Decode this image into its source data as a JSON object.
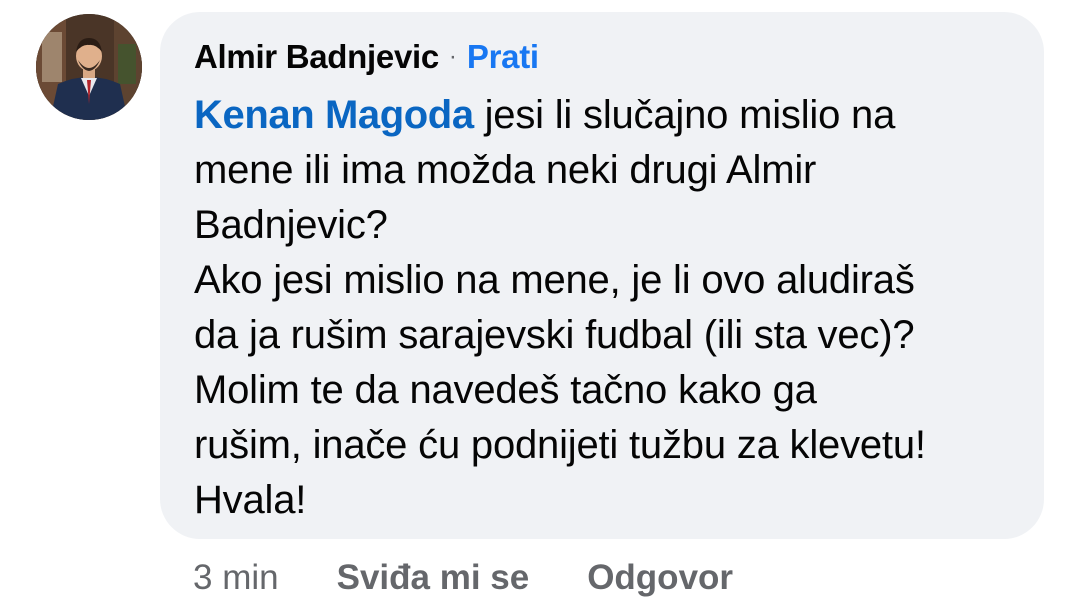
{
  "comment": {
    "author": "Almir Badnjevic",
    "separator": "·",
    "follow_label": "Prati",
    "mention": "Kenan Magoda",
    "lines": [
      " jesi li slučajno mislio na",
      "mene ili ima možda neki drugi Almir",
      "Badnjevic?",
      "Ako jesi mislio na mene, je li ovo aludiraš",
      "da ja rušim sarajevski fudbal (ili sta vec)?",
      "Molim te da navedeš tačno kako ga",
      "rušim, inače ću podnijeti tužbu za klevetu!",
      "Hvala!"
    ]
  },
  "actions": {
    "time": "3 min",
    "like_label": "Sviđa mi se",
    "reply_label": "Odgovor"
  },
  "colors": {
    "bubble_bg": "#f0f2f5",
    "link_blue": "#1877f2",
    "mention_blue": "#0a66c2",
    "text": "#050505",
    "muted": "#65676b"
  }
}
